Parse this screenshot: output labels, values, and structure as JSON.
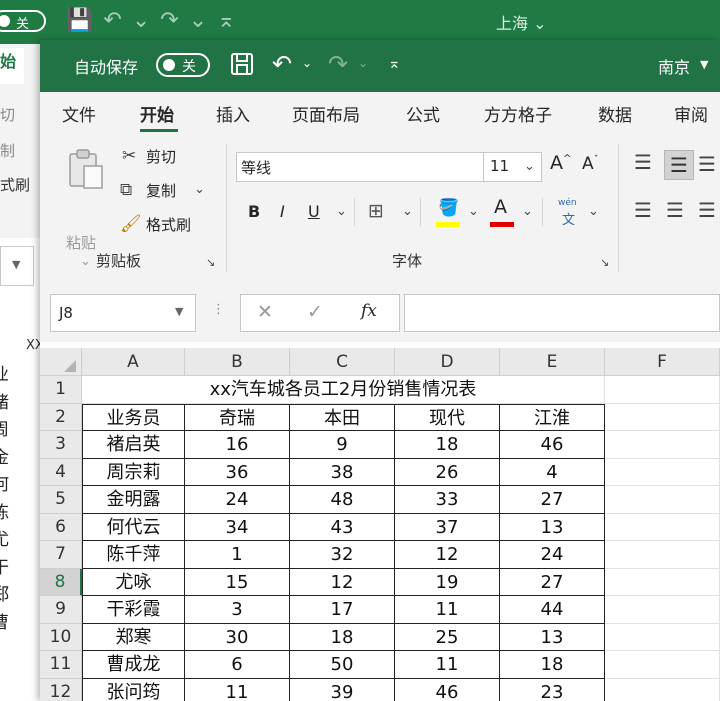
{
  "background_window": {
    "autosave_state": "关",
    "title": "上海",
    "ribbon_fragments": [
      "始",
      "切",
      "制",
      "式刷"
    ],
    "sheet_fragment": "XX",
    "left_cut_text": [
      "业",
      "褚",
      "周",
      "金",
      "何",
      "陈",
      "尤",
      "干",
      "郑",
      "曹"
    ]
  },
  "titlebar": {
    "autosave_label": "自动保存",
    "autosave_state": "关",
    "document_title": "南京",
    "accent_color": "#217346"
  },
  "tabs": [
    "文件",
    "开始",
    "插入",
    "页面布局",
    "公式",
    "方方格子",
    "数据",
    "审阅"
  ],
  "ribbon": {
    "clipboard": {
      "paste_label": "粘贴",
      "cut_label": "剪切",
      "copy_label": "复制",
      "format_painter_label": "格式刷",
      "group_label": "剪贴板"
    },
    "font": {
      "font_name": "等线",
      "font_size": "11",
      "bold": "B",
      "italic": "I",
      "underline": "U",
      "font_color_letter": "A",
      "phonetic_top": "wén",
      "phonetic_bottom": "文",
      "group_label": "字体",
      "fill_color": "#ffff00",
      "font_color": "#e00000"
    }
  },
  "formula_bar": {
    "name_box": "J8",
    "fx": "fx",
    "formula": ""
  },
  "sheet": {
    "columns": [
      "A",
      "B",
      "C",
      "D",
      "E",
      "F"
    ],
    "row_numbers": [
      "1",
      "2",
      "3",
      "4",
      "5",
      "6",
      "7",
      "8",
      "9",
      "10",
      "11",
      "12"
    ],
    "selected_row": "8",
    "title": "xx汽车城各员工2月份销售情况表",
    "headers": [
      "业务员",
      "奇瑞",
      "本田",
      "现代",
      "江淮"
    ],
    "rows": [
      [
        "褚启英",
        "16",
        "9",
        "18",
        "46"
      ],
      [
        "周宗莉",
        "36",
        "38",
        "26",
        "4"
      ],
      [
        "金明露",
        "24",
        "48",
        "33",
        "27"
      ],
      [
        "何代云",
        "34",
        "43",
        "37",
        "13"
      ],
      [
        "陈千萍",
        "1",
        "32",
        "12",
        "24"
      ],
      [
        "尤咏",
        "15",
        "12",
        "19",
        "27"
      ],
      [
        "干彩霞",
        "3",
        "17",
        "11",
        "44"
      ],
      [
        "郑寒",
        "30",
        "18",
        "25",
        "13"
      ],
      [
        "曹成龙",
        "6",
        "50",
        "11",
        "18"
      ],
      [
        "张问筠",
        "11",
        "39",
        "46",
        "23"
      ]
    ]
  }
}
